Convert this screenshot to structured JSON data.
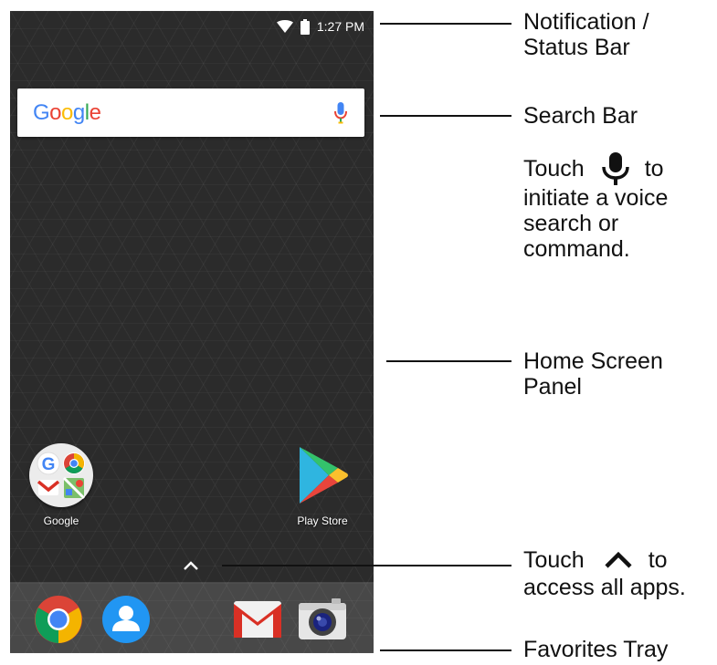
{
  "status_bar": {
    "time": "1:27 PM",
    "icons": [
      "wifi-icon",
      "battery-icon"
    ]
  },
  "search_bar": {
    "logo_letters": [
      {
        "ch": "G",
        "color": "#4285F4"
      },
      {
        "ch": "o",
        "color": "#EA4335"
      },
      {
        "ch": "o",
        "color": "#FBBC05"
      },
      {
        "ch": "g",
        "color": "#4285F4"
      },
      {
        "ch": "l",
        "color": "#34A853"
      },
      {
        "ch": "e",
        "color": "#EA4335"
      }
    ],
    "mic_icon": "mic-icon"
  },
  "home_apps": [
    {
      "label": "Google",
      "icon": "google-folder-icon"
    },
    {
      "label": "Play Store",
      "icon": "play-store-icon"
    }
  ],
  "favorites_tray": [
    {
      "icon": "chrome-icon"
    },
    {
      "icon": "contacts-icon"
    },
    {
      "icon": "gmail-icon"
    },
    {
      "icon": "camera-icon"
    }
  ],
  "callouts": {
    "status": {
      "line1": "Notification /",
      "line2": "Status Bar"
    },
    "search": {
      "title": "Search Bar",
      "touch": "Touch",
      "to": "to",
      "line2": "initiate a voice",
      "line3": "search or",
      "line4": "command."
    },
    "home": {
      "line1": "Home Screen",
      "line2": "Panel"
    },
    "apps": {
      "touch": "Touch",
      "to": "to",
      "line2": "access all apps."
    },
    "tray": {
      "line1": "Favorites Tray"
    }
  },
  "colors": {
    "screen_bg": "#2b2b2b",
    "google_blue": "#4285F4",
    "google_red": "#EA4335",
    "google_yellow": "#FBBC05",
    "google_green": "#34A853"
  }
}
